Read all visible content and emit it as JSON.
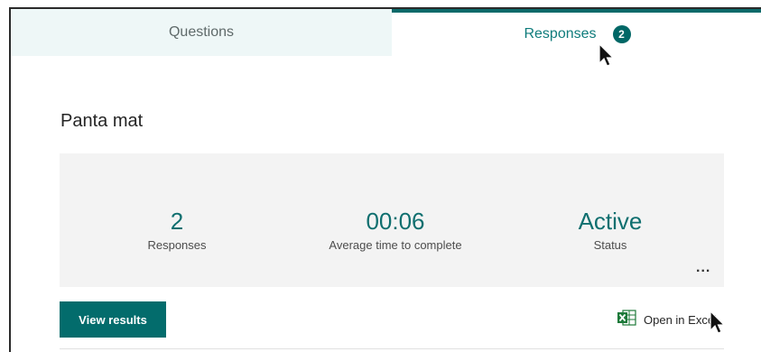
{
  "tabs": {
    "questions_label": "Questions",
    "responses_label": "Responses",
    "responses_badge": "2"
  },
  "form": {
    "title": "Panta mat"
  },
  "summary": {
    "responses_value": "2",
    "responses_caption": "Responses",
    "avg_time_value": "00:06",
    "avg_time_caption": "Average time to complete",
    "status_value": "Active",
    "status_caption": "Status",
    "more_label": "..."
  },
  "actions": {
    "view_results_label": "View results",
    "open_excel_label": "Open in Excel",
    "excel_icon": "excel-icon"
  },
  "colors": {
    "accent": "#0b6a6a",
    "tab_inactive_bg": "#eef7f7",
    "summary_bg": "#f3f3f3"
  }
}
